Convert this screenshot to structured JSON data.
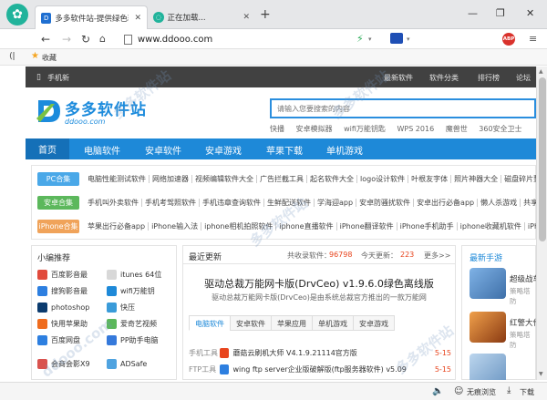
{
  "tabs": [
    {
      "title": "多多软件站-提供绿色软件",
      "active": true
    },
    {
      "title": "正在加载...",
      "active": false
    }
  ],
  "address": {
    "url": "www.ddooo.com"
  },
  "bookmarks": {
    "label": "收藏"
  },
  "site": {
    "topbar": {
      "mobile": "手机新",
      "links": [
        "最新软件",
        "软件分类",
        "排行榜",
        "论坛"
      ]
    },
    "logo_text": "多多软件站",
    "logo_sub": "ddooo.com",
    "search_placeholder": "请输入您要搜索的内容",
    "hotlinks": [
      "快播",
      "安卓模拟器",
      "wifi万能钥匙",
      "WPS 2016",
      "魔兽世",
      "360安全卫士"
    ],
    "nav": [
      "首页",
      "电脑软件",
      "安卓软件",
      "安卓游戏",
      "苹果下载",
      "单机游戏"
    ],
    "categories": [
      {
        "badge": "PC合集",
        "color": "#4aa8e8",
        "links": [
          "电脑性能测试软件",
          "网络加速器",
          "视频编辑软件大全",
          "广告拦截工具",
          "起名软件大全",
          "logo设计软件",
          "叶根友字体",
          "照片神器大全",
          "磁盘碎片整"
        ]
      },
      {
        "badge": "安卓合集",
        "color": "#5cb85c",
        "links": [
          "手机叫外卖软件",
          "手机考驾照软件",
          "手机违章查询软件",
          "生鲜配送软件",
          "学海迎app",
          "安卓防骚扰软件",
          "安卓出行必备app",
          "懒人杀游戏",
          "共享汽车"
        ]
      },
      {
        "badge": "iPhone合集",
        "color": "#f0a35a",
        "links": [
          "苹果出行必备app",
          "iPhone输入法",
          "iphone相机拍照软件",
          "iphone直播软件",
          "iPhone翻译软件",
          "iPhone手机助手",
          "iphone收藏机软件",
          "iPhone"
        ]
      }
    ],
    "editor": {
      "title": "小编推荐",
      "items": [
        {
          "name": "百度影音最",
          "color": "#e14a3c"
        },
        {
          "name": "itunes 64位",
          "color": "#d8d8d8"
        },
        {
          "name": "搜狗影音最",
          "color": "#2d7fe0"
        },
        {
          "name": "wifi万能钥",
          "color": "#1e89d8"
        },
        {
          "name": "photoshop",
          "color": "#0b3b6e"
        },
        {
          "name": "快压",
          "color": "#3a9bd9"
        },
        {
          "name": "快用苹果助",
          "color": "#ef6c1e"
        },
        {
          "name": "爱奇艺视频",
          "color": "#5cb85c"
        },
        {
          "name": "百度网盘",
          "color": "#2d7fe0"
        },
        {
          "name": "PP助手电脑",
          "color": "#3579db"
        },
        {
          "name": "会商会影X9",
          "color": "#d9534f"
        },
        {
          "name": "ADSafe",
          "color": "#4fa3e0"
        }
      ]
    },
    "updates": {
      "title": "最近更新",
      "total_label": "共收录软件：",
      "total": "96798",
      "today_label": "今天更新：",
      "today": "223",
      "more": "更多>>",
      "headline": "驱动总裁万能网卡版(DrvCeo) v1.9.6.0绿色离线版",
      "subline": "驱动总裁万能网卡版(DrvCeo)是由系统总裁官方推出的一款万能网",
      "tabs": [
        "电脑软件",
        "安卓软件",
        "苹果应用",
        "单机游戏",
        "安卓游戏"
      ],
      "rows": [
        {
          "cat": "手机工具",
          "name": "蘑菇云刷机大师 V4.1.9.21114官方版",
          "date": "5-15"
        },
        {
          "cat": "FTP工具",
          "name": "wing ftp server企业版破解版(ftp服务器软件) v5.09",
          "date": "5-15"
        }
      ]
    },
    "games": {
      "title": "最新手游",
      "items": [
        {
          "name": "超级战车大",
          "sub": "策略塔防"
        },
        {
          "name": "红警大作战",
          "sub": "策略塔防"
        },
        {
          "name": "",
          "sub": ""
        }
      ]
    }
  },
  "status": {
    "mode": "无痕浏览",
    "download": "下载"
  }
}
